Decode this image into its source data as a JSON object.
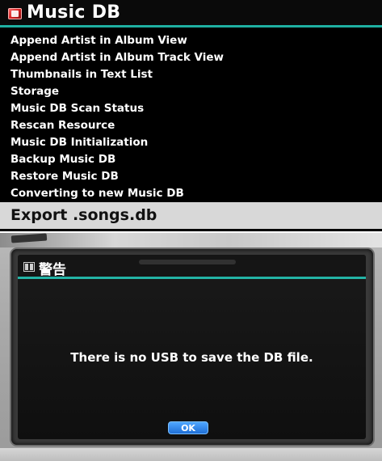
{
  "music_db": {
    "title": "Music DB",
    "title_icon": "music-db-folder-icon",
    "accent_color": "#1fb0a2",
    "items": [
      "Append Artist in Album View",
      "Append Artist in Album Track View",
      "Thumbnails in Text List",
      "Storage",
      "Music DB Scan Status",
      "Rescan Resource",
      "Music DB Initialization",
      "Backup Music DB",
      "Restore Music DB",
      "Converting to new Music DB"
    ],
    "selected_item": "Export .songs.db"
  },
  "dialog": {
    "title": "警告",
    "title_icon": "grid-icon",
    "message": "There is no USB to save the DB file.",
    "ok_label": "OK",
    "ok_color": "#1f6fd6"
  }
}
